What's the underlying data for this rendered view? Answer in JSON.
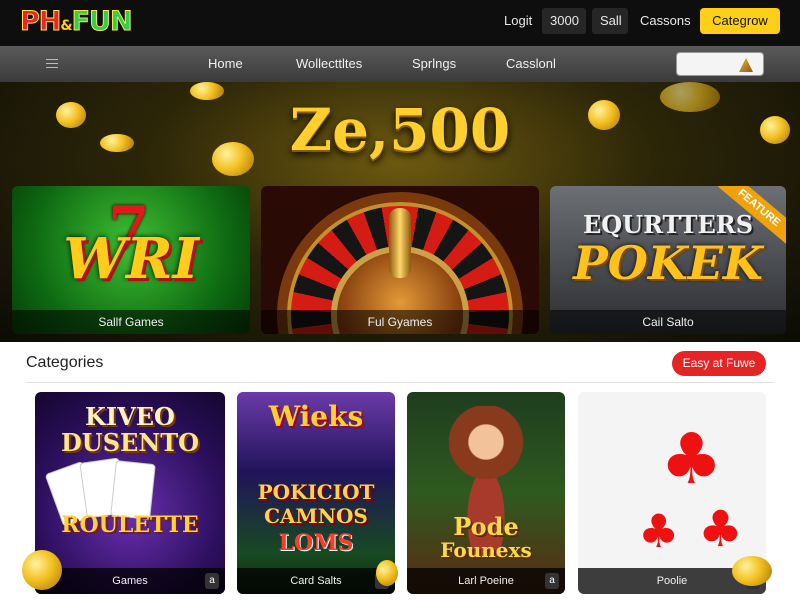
{
  "header": {
    "logo": {
      "part1": "PH",
      "amp": "&",
      "part2": "FUN"
    },
    "links": [
      "Logit",
      "3000",
      "Sall",
      "Cassons"
    ],
    "cta": "Categrow"
  },
  "nav": {
    "items": [
      "Home",
      "Wollecttltes",
      "Sprlngs",
      "Casslonl"
    ]
  },
  "hero": {
    "jackpot": "Ze,500"
  },
  "featured": [
    {
      "caption": "Sallf Games",
      "title": "WRI",
      "seven": "7"
    },
    {
      "caption": "Ful Gyames"
    },
    {
      "caption": "Cail Salto",
      "subtitle": "EQURTTERS",
      "title": "POKEK",
      "ribbon": "FEATURE"
    }
  ],
  "categories": {
    "title": "Categories",
    "button": "Easy at Fuwe",
    "cards": [
      {
        "line1": "KIVEO",
        "line2": "DUSENTO",
        "line3": "ROULETTE",
        "caption": "Games",
        "badge": "a"
      },
      {
        "line1": "Wieks",
        "line2": "POKICIOT",
        "line3": "CAMNOS",
        "line4": "LOMS",
        "caption": "Card Salts",
        "badge": "a"
      },
      {
        "line1": "Pode",
        "line2": "Founexs",
        "caption": "Larl Poeine",
        "badge": "a"
      },
      {
        "caption": "Poolie",
        "badge": "a"
      }
    ]
  },
  "colors": {
    "accent": "#fdd017",
    "red": "#e52525",
    "topbar": "#0e0e0e"
  }
}
